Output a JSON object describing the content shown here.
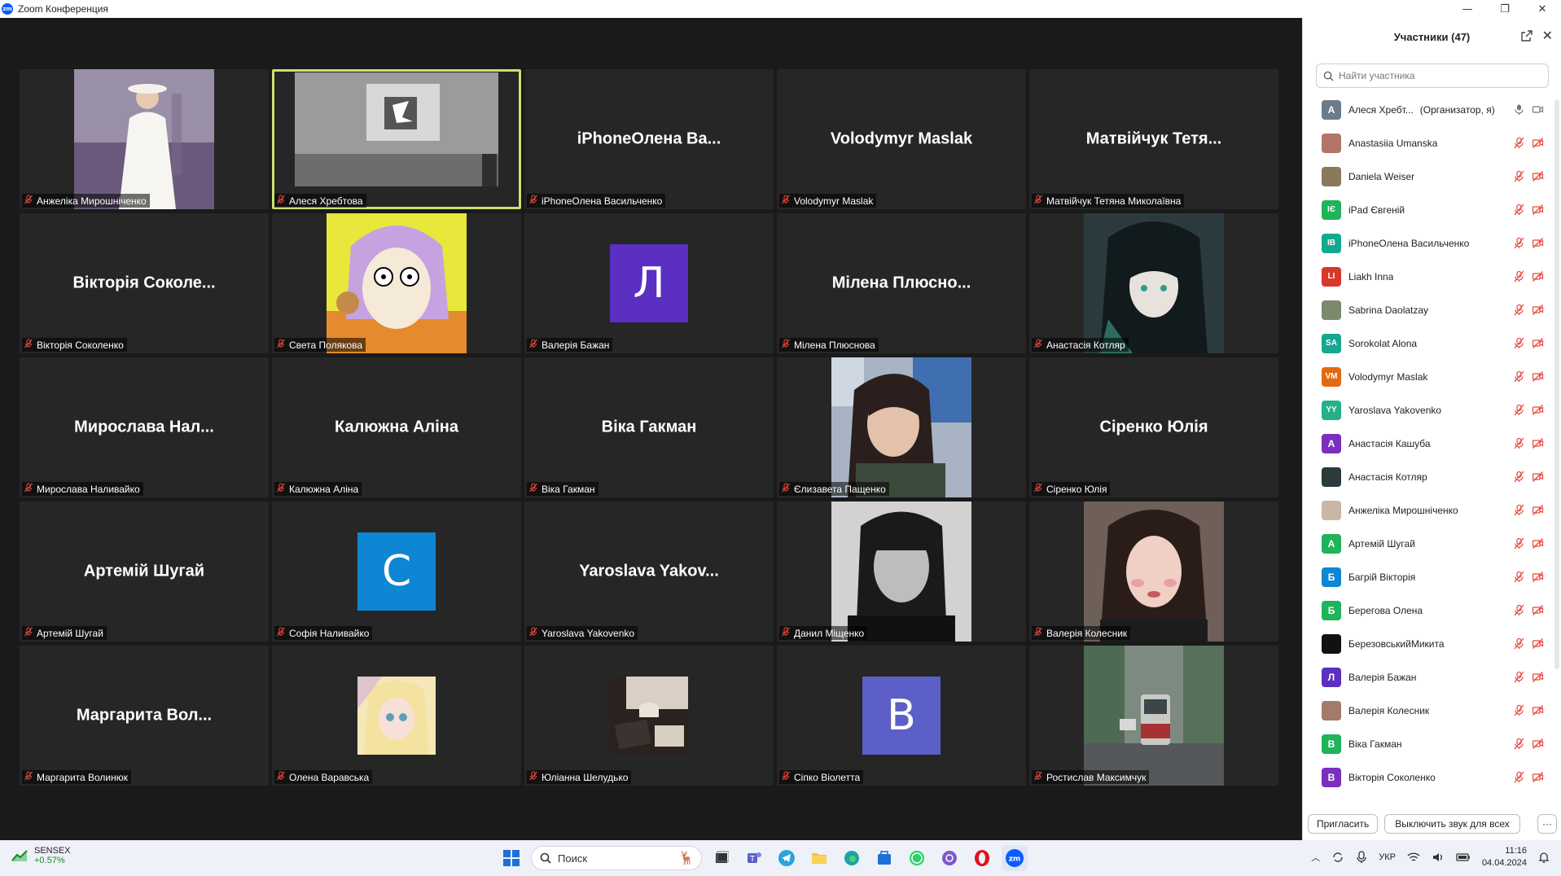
{
  "window": {
    "title": "Zoom Конференция",
    "controls": [
      "—",
      "❐",
      "✕"
    ]
  },
  "tiles": [
    {
      "name": "Анжеліка Мирошніченко",
      "kind": "photo",
      "photo": "woman-white-dress"
    },
    {
      "name": "Алеся Хребтова",
      "kind": "photo",
      "photo": "projector-screen",
      "active": true
    },
    {
      "name": "iPhoneОлена Васильченко",
      "kind": "name",
      "big": "iPhoneОлена  Ва..."
    },
    {
      "name": "Volodymyr Maslak",
      "kind": "name",
      "big": "Volodymyr Maslak"
    },
    {
      "name": "Матвійчук Тетяна Миколаївна",
      "kind": "name",
      "big": "Матвійчук  Тетя..."
    },
    {
      "name": "Вікторія Соколенко",
      "kind": "name",
      "big": "Вікторія  Соколе..."
    },
    {
      "name": "Света Полякова",
      "kind": "photo",
      "photo": "comic-character"
    },
    {
      "name": "Валерія Бажан",
      "kind": "letter",
      "letter": "Л",
      "color": "#5a2fc2"
    },
    {
      "name": "Мілена Плюснова",
      "kind": "name",
      "big": "Мілена  Плюсно..."
    },
    {
      "name": "Анастасія Котляр",
      "kind": "photo",
      "photo": "anime-dark-hair"
    },
    {
      "name": "Мирослава Наливайко",
      "kind": "name",
      "big": "Мирослава  Нал..."
    },
    {
      "name": "Калюжна Аліна",
      "kind": "name",
      "big": "Калюжна Аліна"
    },
    {
      "name": "Віка Гакман",
      "kind": "name",
      "big": "Віка Гакман"
    },
    {
      "name": "Єлизавета Пащенко",
      "kind": "photo",
      "photo": "girl-bus"
    },
    {
      "name": "Сіренко Юлія",
      "kind": "name",
      "big": "Сіренко Юлія"
    },
    {
      "name": "Артемій Шугай",
      "kind": "name",
      "big": "Артемій Шугай"
    },
    {
      "name": "Софія Наливайко",
      "kind": "letter",
      "letter": "С",
      "color": "#0e86d4"
    },
    {
      "name": "Yaroslava Yakovenko",
      "kind": "name",
      "big": "Yaroslava  Yakov..."
    },
    {
      "name": "Данил Міщенко",
      "kind": "photo",
      "photo": "bw-portrait"
    },
    {
      "name": "Валерія Колесник",
      "kind": "photo",
      "photo": "girl-selfie"
    },
    {
      "name": "Маргарита Волинюк",
      "kind": "name",
      "big": "Маргарита  Вол..."
    },
    {
      "name": "Олена Варавська",
      "kind": "small",
      "photo": "anime-pastel"
    },
    {
      "name": "Юліанна Шелудько",
      "kind": "small",
      "photo": "coffee-table"
    },
    {
      "name": "Сіпко Віолетта",
      "kind": "letter",
      "letter": "В",
      "color": "#5b5fc7"
    },
    {
      "name": "Ростислав Максимчук",
      "kind": "photo",
      "photo": "tram-rain"
    }
  ],
  "panel": {
    "title": "Участники (47)",
    "search_placeholder": "Найти участника",
    "participants": [
      {
        "name": "Алеся Хребт...",
        "role": "(Организатор, я)",
        "avatar": "А",
        "color": "#6b7b8c",
        "host": true
      },
      {
        "name": "Anastasiia Umanska",
        "avatar": "",
        "color": "#b5746a"
      },
      {
        "name": "Daniela Weiser",
        "avatar": "",
        "color": "#8a7a5c"
      },
      {
        "name": "iPad Євгеній",
        "avatar": "IЄ",
        "color": "#1fb45a"
      },
      {
        "name": "iPhoneОлена Васильченко",
        "avatar": "IB",
        "color": "#14a891"
      },
      {
        "name": "Liakh Inna",
        "avatar": "LI",
        "color": "#d9372b"
      },
      {
        "name": "Sabrina Daolatzay",
        "avatar": "",
        "color": "#7a8a6a"
      },
      {
        "name": "Sorokolat Alona",
        "avatar": "SA",
        "color": "#14a891"
      },
      {
        "name": "Volodymyr Maslak",
        "avatar": "VM",
        "color": "#e36a12"
      },
      {
        "name": "Yaroslava Yakovenko",
        "avatar": "YY",
        "color": "#26b08a"
      },
      {
        "name": "Анастасія Кашуба",
        "avatar": "А",
        "color": "#7a2fbf"
      },
      {
        "name": "Анастасія Котляр",
        "avatar": "",
        "color": "#2b3a3a"
      },
      {
        "name": "Анжеліка Мирошніченко",
        "avatar": "",
        "color": "#c9b7a6"
      },
      {
        "name": "Артемій Шугай",
        "avatar": "А",
        "color": "#1fb45a"
      },
      {
        "name": "Багрій Вікторія",
        "avatar": "Б",
        "color": "#0e86d4"
      },
      {
        "name": "Берегова Олена",
        "avatar": "Б",
        "color": "#1fb45a"
      },
      {
        "name": "БерезовськийМикита",
        "avatar": "",
        "color": "#111111"
      },
      {
        "name": "Валерія Бажан",
        "avatar": "Л",
        "color": "#5a2fc2"
      },
      {
        "name": "Валерія Колесник",
        "avatar": "",
        "color": "#a27b6b"
      },
      {
        "name": "Віка Гакман",
        "avatar": "В",
        "color": "#1fb45a"
      },
      {
        "name": "Вікторія Соколенко",
        "avatar": "В",
        "color": "#7a2fbf"
      }
    ],
    "invite_label": "Пригласить",
    "mute_all_label": "Выключить звук для всех",
    "more_label": "···"
  },
  "taskbar": {
    "ticker_name": "SENSEX",
    "ticker_change": "+0.57%",
    "search_label": "Поиск",
    "language": "УКР",
    "time": "11:16",
    "date": "04.04.2024"
  }
}
